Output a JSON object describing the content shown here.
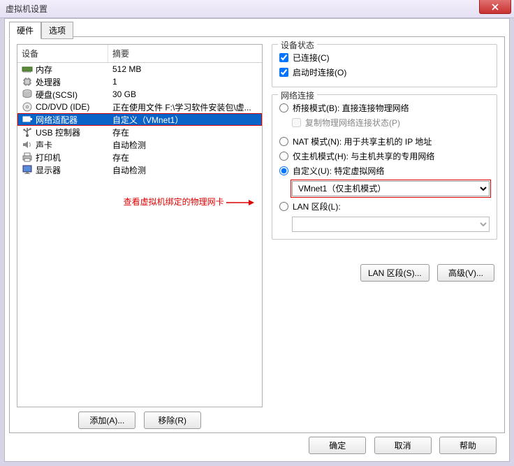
{
  "title": "虚拟机设置",
  "tabs": {
    "hardware": "硬件",
    "options": "选项"
  },
  "headers": {
    "device": "设备",
    "summary": "摘要"
  },
  "devices": [
    {
      "id": "memory",
      "name": "内存",
      "summary": "512 MB"
    },
    {
      "id": "cpu",
      "name": "处理器",
      "summary": "1"
    },
    {
      "id": "hdd",
      "name": "硬盘(SCSI)",
      "summary": "30 GB"
    },
    {
      "id": "cddvd",
      "name": "CD/DVD (IDE)",
      "summary": "正在使用文件 F:\\学习软件安装包\\虚..."
    },
    {
      "id": "netadpt",
      "name": "网络适配器",
      "summary": "自定义（VMnet1）",
      "selected": true
    },
    {
      "id": "usb",
      "name": "USB 控制器",
      "summary": "存在"
    },
    {
      "id": "sound",
      "name": "声卡",
      "summary": "自动检测"
    },
    {
      "id": "printer",
      "name": "打印机",
      "summary": "存在"
    },
    {
      "id": "display",
      "name": "显示器",
      "summary": "自动检测"
    }
  ],
  "buttons": {
    "add": "添加(A)...",
    "remove": "移除(R)",
    "lanSegments": "LAN 区段(S)...",
    "advanced": "高级(V)...",
    "ok": "确定",
    "cancel": "取消",
    "help": "帮助"
  },
  "status": {
    "legend": "设备状态",
    "connected": "已连接(C)",
    "connectAtPowerOn": "启动时连接(O)"
  },
  "netconn": {
    "legend": "网络连接",
    "bridged": "桥接模式(B): 直接连接物理网络",
    "replicate": "复制物理网络连接状态(P)",
    "nat": "NAT 模式(N): 用于共享主机的 IP 地址",
    "hostonly": "仅主机模式(H): 与主机共享的专用网络",
    "custom": "自定义(U): 特定虚拟网络",
    "customValue": "VMnet1（仅主机模式）",
    "lanseg": "LAN 区段(L):",
    "lansegValue": ""
  },
  "annotation": "查看虚拟机绑定的物理网卡"
}
